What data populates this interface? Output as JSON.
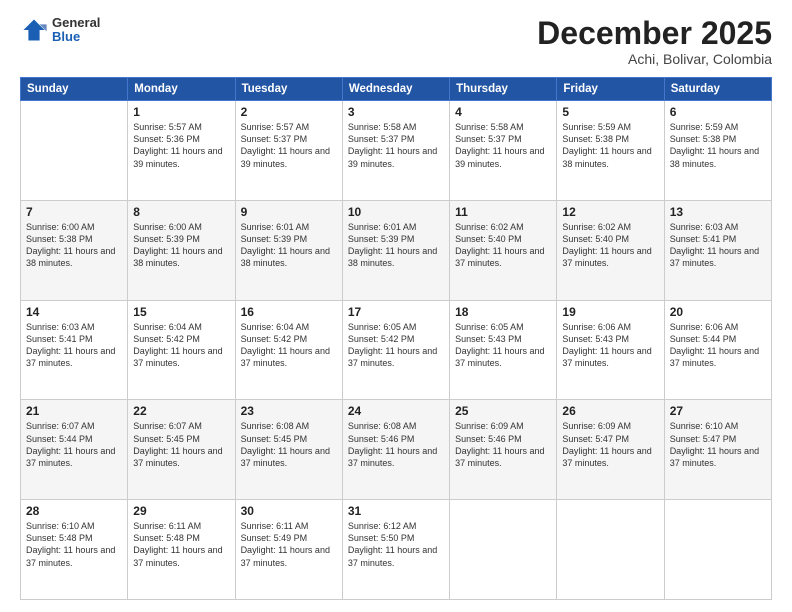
{
  "header": {
    "logo": {
      "general": "General",
      "blue": "Blue"
    },
    "month": "December 2025",
    "location": "Achi, Bolivar, Colombia"
  },
  "weekdays": [
    "Sunday",
    "Monday",
    "Tuesday",
    "Wednesday",
    "Thursday",
    "Friday",
    "Saturday"
  ],
  "weeks": [
    [
      {
        "day": "",
        "sunrise": "",
        "sunset": "",
        "daylight": ""
      },
      {
        "day": "1",
        "sunrise": "Sunrise: 5:57 AM",
        "sunset": "Sunset: 5:36 PM",
        "daylight": "Daylight: 11 hours and 39 minutes."
      },
      {
        "day": "2",
        "sunrise": "Sunrise: 5:57 AM",
        "sunset": "Sunset: 5:37 PM",
        "daylight": "Daylight: 11 hours and 39 minutes."
      },
      {
        "day": "3",
        "sunrise": "Sunrise: 5:58 AM",
        "sunset": "Sunset: 5:37 PM",
        "daylight": "Daylight: 11 hours and 39 minutes."
      },
      {
        "day": "4",
        "sunrise": "Sunrise: 5:58 AM",
        "sunset": "Sunset: 5:37 PM",
        "daylight": "Daylight: 11 hours and 39 minutes."
      },
      {
        "day": "5",
        "sunrise": "Sunrise: 5:59 AM",
        "sunset": "Sunset: 5:38 PM",
        "daylight": "Daylight: 11 hours and 38 minutes."
      },
      {
        "day": "6",
        "sunrise": "Sunrise: 5:59 AM",
        "sunset": "Sunset: 5:38 PM",
        "daylight": "Daylight: 11 hours and 38 minutes."
      }
    ],
    [
      {
        "day": "7",
        "sunrise": "Sunrise: 6:00 AM",
        "sunset": "Sunset: 5:38 PM",
        "daylight": "Daylight: 11 hours and 38 minutes."
      },
      {
        "day": "8",
        "sunrise": "Sunrise: 6:00 AM",
        "sunset": "Sunset: 5:39 PM",
        "daylight": "Daylight: 11 hours and 38 minutes."
      },
      {
        "day": "9",
        "sunrise": "Sunrise: 6:01 AM",
        "sunset": "Sunset: 5:39 PM",
        "daylight": "Daylight: 11 hours and 38 minutes."
      },
      {
        "day": "10",
        "sunrise": "Sunrise: 6:01 AM",
        "sunset": "Sunset: 5:39 PM",
        "daylight": "Daylight: 11 hours and 38 minutes."
      },
      {
        "day": "11",
        "sunrise": "Sunrise: 6:02 AM",
        "sunset": "Sunset: 5:40 PM",
        "daylight": "Daylight: 11 hours and 37 minutes."
      },
      {
        "day": "12",
        "sunrise": "Sunrise: 6:02 AM",
        "sunset": "Sunset: 5:40 PM",
        "daylight": "Daylight: 11 hours and 37 minutes."
      },
      {
        "day": "13",
        "sunrise": "Sunrise: 6:03 AM",
        "sunset": "Sunset: 5:41 PM",
        "daylight": "Daylight: 11 hours and 37 minutes."
      }
    ],
    [
      {
        "day": "14",
        "sunrise": "Sunrise: 6:03 AM",
        "sunset": "Sunset: 5:41 PM",
        "daylight": "Daylight: 11 hours and 37 minutes."
      },
      {
        "day": "15",
        "sunrise": "Sunrise: 6:04 AM",
        "sunset": "Sunset: 5:42 PM",
        "daylight": "Daylight: 11 hours and 37 minutes."
      },
      {
        "day": "16",
        "sunrise": "Sunrise: 6:04 AM",
        "sunset": "Sunset: 5:42 PM",
        "daylight": "Daylight: 11 hours and 37 minutes."
      },
      {
        "day": "17",
        "sunrise": "Sunrise: 6:05 AM",
        "sunset": "Sunset: 5:42 PM",
        "daylight": "Daylight: 11 hours and 37 minutes."
      },
      {
        "day": "18",
        "sunrise": "Sunrise: 6:05 AM",
        "sunset": "Sunset: 5:43 PM",
        "daylight": "Daylight: 11 hours and 37 minutes."
      },
      {
        "day": "19",
        "sunrise": "Sunrise: 6:06 AM",
        "sunset": "Sunset: 5:43 PM",
        "daylight": "Daylight: 11 hours and 37 minutes."
      },
      {
        "day": "20",
        "sunrise": "Sunrise: 6:06 AM",
        "sunset": "Sunset: 5:44 PM",
        "daylight": "Daylight: 11 hours and 37 minutes."
      }
    ],
    [
      {
        "day": "21",
        "sunrise": "Sunrise: 6:07 AM",
        "sunset": "Sunset: 5:44 PM",
        "daylight": "Daylight: 11 hours and 37 minutes."
      },
      {
        "day": "22",
        "sunrise": "Sunrise: 6:07 AM",
        "sunset": "Sunset: 5:45 PM",
        "daylight": "Daylight: 11 hours and 37 minutes."
      },
      {
        "day": "23",
        "sunrise": "Sunrise: 6:08 AM",
        "sunset": "Sunset: 5:45 PM",
        "daylight": "Daylight: 11 hours and 37 minutes."
      },
      {
        "day": "24",
        "sunrise": "Sunrise: 6:08 AM",
        "sunset": "Sunset: 5:46 PM",
        "daylight": "Daylight: 11 hours and 37 minutes."
      },
      {
        "day": "25",
        "sunrise": "Sunrise: 6:09 AM",
        "sunset": "Sunset: 5:46 PM",
        "daylight": "Daylight: 11 hours and 37 minutes."
      },
      {
        "day": "26",
        "sunrise": "Sunrise: 6:09 AM",
        "sunset": "Sunset: 5:47 PM",
        "daylight": "Daylight: 11 hours and 37 minutes."
      },
      {
        "day": "27",
        "sunrise": "Sunrise: 6:10 AM",
        "sunset": "Sunset: 5:47 PM",
        "daylight": "Daylight: 11 hours and 37 minutes."
      }
    ],
    [
      {
        "day": "28",
        "sunrise": "Sunrise: 6:10 AM",
        "sunset": "Sunset: 5:48 PM",
        "daylight": "Daylight: 11 hours and 37 minutes."
      },
      {
        "day": "29",
        "sunrise": "Sunrise: 6:11 AM",
        "sunset": "Sunset: 5:48 PM",
        "daylight": "Daylight: 11 hours and 37 minutes."
      },
      {
        "day": "30",
        "sunrise": "Sunrise: 6:11 AM",
        "sunset": "Sunset: 5:49 PM",
        "daylight": "Daylight: 11 hours and 37 minutes."
      },
      {
        "day": "31",
        "sunrise": "Sunrise: 6:12 AM",
        "sunset": "Sunset: 5:50 PM",
        "daylight": "Daylight: 11 hours and 37 minutes."
      },
      {
        "day": "",
        "sunrise": "",
        "sunset": "",
        "daylight": ""
      },
      {
        "day": "",
        "sunrise": "",
        "sunset": "",
        "daylight": ""
      },
      {
        "day": "",
        "sunrise": "",
        "sunset": "",
        "daylight": ""
      }
    ]
  ]
}
